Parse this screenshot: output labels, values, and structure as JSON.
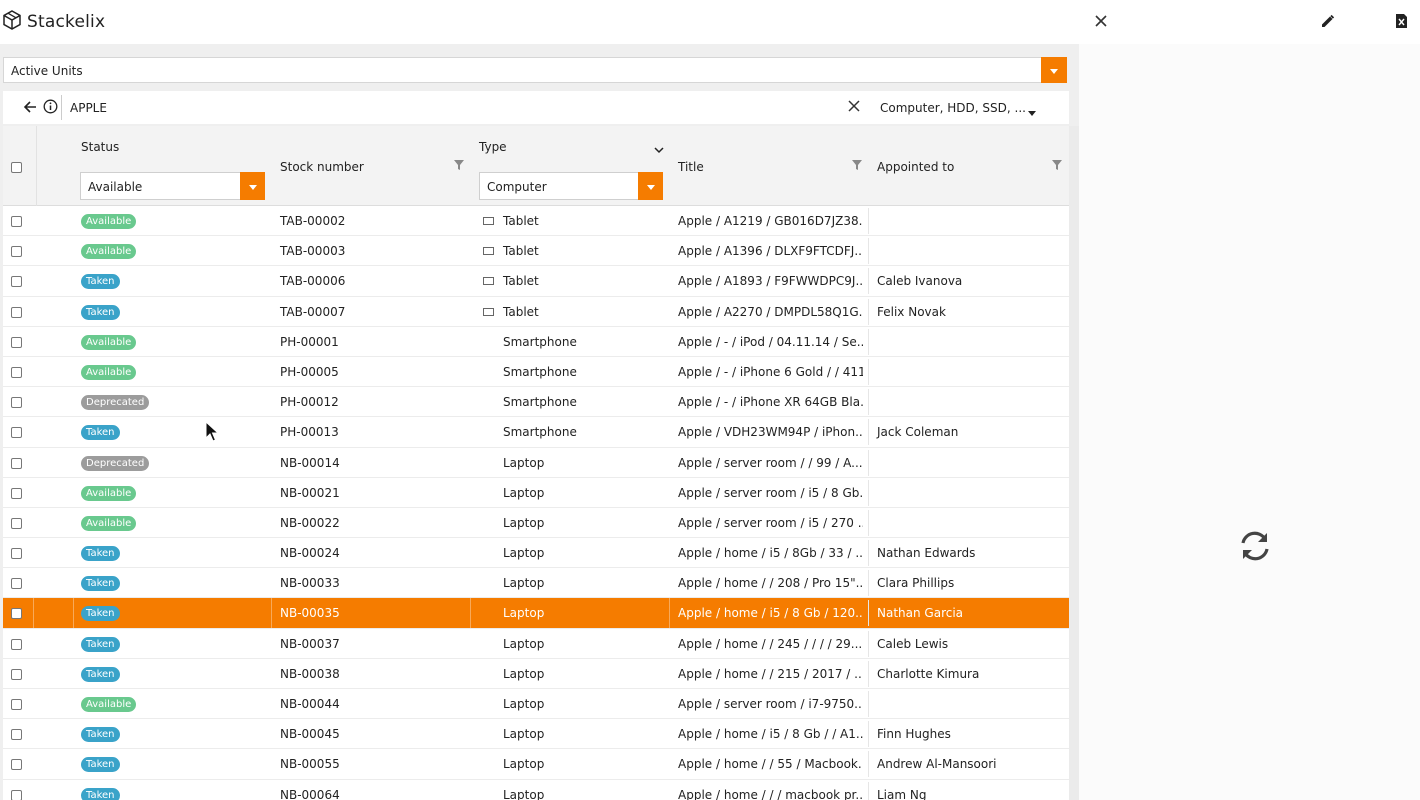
{
  "app": {
    "name": "Stackelix"
  },
  "topbar_icons": [
    "close-icon",
    "edit-pencil-icon",
    "export-file-icon"
  ],
  "view_selector": {
    "value": "Active Units"
  },
  "breadcrumb": {
    "text": "APPLE",
    "category_filter": "Computer, HDD, SSD, ..."
  },
  "columns": {
    "status": "Status",
    "stock_number": "Stock number",
    "type": "Type",
    "title": "Title",
    "appointed_to": "Appointed to"
  },
  "filters": {
    "status_value": "Available",
    "type_value": "Computer"
  },
  "rows": [
    {
      "status": "Available",
      "status_class": "available",
      "stock": "TAB-00002",
      "type": "Tablet",
      "type_icon": true,
      "title": "Apple / A1219 / GB016D7JZ38...",
      "appointed": ""
    },
    {
      "status": "Available",
      "status_class": "available",
      "stock": "TAB-00003",
      "type": "Tablet",
      "type_icon": true,
      "title": "Apple / A1396 / DLXF9FTCDFJ...",
      "appointed": ""
    },
    {
      "status": "Taken",
      "status_class": "taken",
      "stock": "TAB-00006",
      "type": "Tablet",
      "type_icon": true,
      "title": "Apple / A1893 / F9FWWDPC9J...",
      "appointed": "Caleb Ivanova"
    },
    {
      "status": "Taken",
      "status_class": "taken",
      "stock": "TAB-00007",
      "type": "Tablet",
      "type_icon": true,
      "title": "Apple / A2270 / DMPDL58Q1G...",
      "appointed": "Felix Novak"
    },
    {
      "status": "Available",
      "status_class": "available",
      "stock": "PH-00001",
      "type": "Smartphone",
      "type_icon": false,
      "title": "Apple / - / iPod / 04.11.14 / Se...",
      "appointed": ""
    },
    {
      "status": "Available",
      "status_class": "available",
      "stock": "PH-00005",
      "type": "Smartphone",
      "type_icon": false,
      "title": "Apple / - / iPhone 6 Gold / / 411",
      "appointed": ""
    },
    {
      "status": "Deprecated",
      "status_class": "deprecated",
      "stock": "PH-00012",
      "type": "Smartphone",
      "type_icon": false,
      "title": "Apple / - / iPhone XR 64GB Bla...",
      "appointed": ""
    },
    {
      "status": "Taken",
      "status_class": "taken",
      "stock": "PH-00013",
      "type": "Smartphone",
      "type_icon": false,
      "title": "Apple / VDH23WM94P / iPhon...",
      "appointed": "Jack Coleman"
    },
    {
      "status": "Deprecated",
      "status_class": "deprecated",
      "stock": "NB-00014",
      "type": "Laptop",
      "type_icon": false,
      "title": "Apple / server room / / 99 / A...",
      "appointed": ""
    },
    {
      "status": "Available",
      "status_class": "available",
      "stock": "NB-00021",
      "type": "Laptop",
      "type_icon": false,
      "title": "Apple / server room / i5 / 8 Gb...",
      "appointed": ""
    },
    {
      "status": "Available",
      "status_class": "available",
      "stock": "NB-00022",
      "type": "Laptop",
      "type_icon": false,
      "title": "Apple / server room / i5 / 270 ...",
      "appointed": ""
    },
    {
      "status": "Taken",
      "status_class": "taken",
      "stock": "NB-00024",
      "type": "Laptop",
      "type_icon": false,
      "title": "Apple / home / i5 / 8Gb / 33 / ...",
      "appointed": "Nathan Edwards"
    },
    {
      "status": "Taken",
      "status_class": "taken",
      "stock": "NB-00033",
      "type": "Laptop",
      "type_icon": false,
      "title": "Apple / home / / 208 / Pro 15\"...",
      "appointed": "Clara Phillips"
    },
    {
      "status": "Taken",
      "status_class": "taken",
      "stock": "NB-00035",
      "type": "Laptop",
      "type_icon": false,
      "title": "Apple / home / i5 / 8 Gb / 120...",
      "appointed": "Nathan Garcia",
      "selected": true
    },
    {
      "status": "Taken",
      "status_class": "taken",
      "stock": "NB-00037",
      "type": "Laptop",
      "type_icon": false,
      "title": "Apple / home / / 245 / / / / 29...",
      "appointed": "Caleb Lewis"
    },
    {
      "status": "Taken",
      "status_class": "taken",
      "stock": "NB-00038",
      "type": "Laptop",
      "type_icon": false,
      "title": "Apple / home / / 215 / 2017 / ...",
      "appointed": "Charlotte Kimura"
    },
    {
      "status": "Available",
      "status_class": "available",
      "stock": "NB-00044",
      "type": "Laptop",
      "type_icon": false,
      "title": "Apple / server room / i7-9750...",
      "appointed": ""
    },
    {
      "status": "Taken",
      "status_class": "taken",
      "stock": "NB-00045",
      "type": "Laptop",
      "type_icon": false,
      "title": "Apple / home / i5 / 8 Gb / / A1...",
      "appointed": "Finn Hughes"
    },
    {
      "status": "Taken",
      "status_class": "taken",
      "stock": "NB-00055",
      "type": "Laptop",
      "type_icon": false,
      "title": "Apple / home / / 55 / Macbook...",
      "appointed": "Andrew Al-Mansoori"
    },
    {
      "status": "Taken",
      "status_class": "taken",
      "stock": "NB-00064",
      "type": "Laptop",
      "type_icon": false,
      "title": "Apple / home / / / macbook pr...",
      "appointed": "Liam Ng"
    }
  ],
  "colors": {
    "accent": "#f57c00",
    "available": "#69c98e",
    "taken": "#3aa3c9",
    "deprecated": "#9c9c9c"
  },
  "right_panel": {
    "icon": "refresh-icon"
  }
}
